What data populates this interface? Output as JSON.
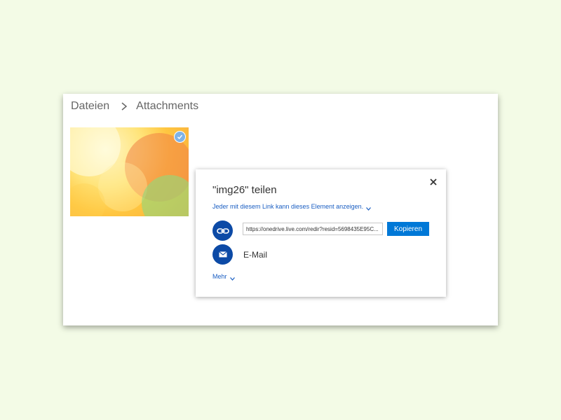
{
  "breadcrumb": {
    "root": "Dateien",
    "current": "Attachments"
  },
  "thumbnail": {
    "selected": true
  },
  "share_dialog": {
    "title": "\"img26\" teilen",
    "permission_text": "Jeder mit diesem Link kann dieses Element anzeigen.",
    "link_value": "https://onedrive.live.com/redir?resid=5698435E95C...",
    "copy_label": "Kopieren",
    "email_label": "E-Mail",
    "more_label": "Mehr"
  },
  "colors": {
    "background": "#f3fbe6",
    "accent": "#0078d7",
    "icon_circle": "#0c4aa6",
    "link_text": "#1a5ec2"
  },
  "icons": {
    "close": "close-icon",
    "link": "link-icon",
    "mail": "mail-icon",
    "check": "checkmark-icon",
    "breadcrumb_sep": "chevron-right-icon"
  }
}
